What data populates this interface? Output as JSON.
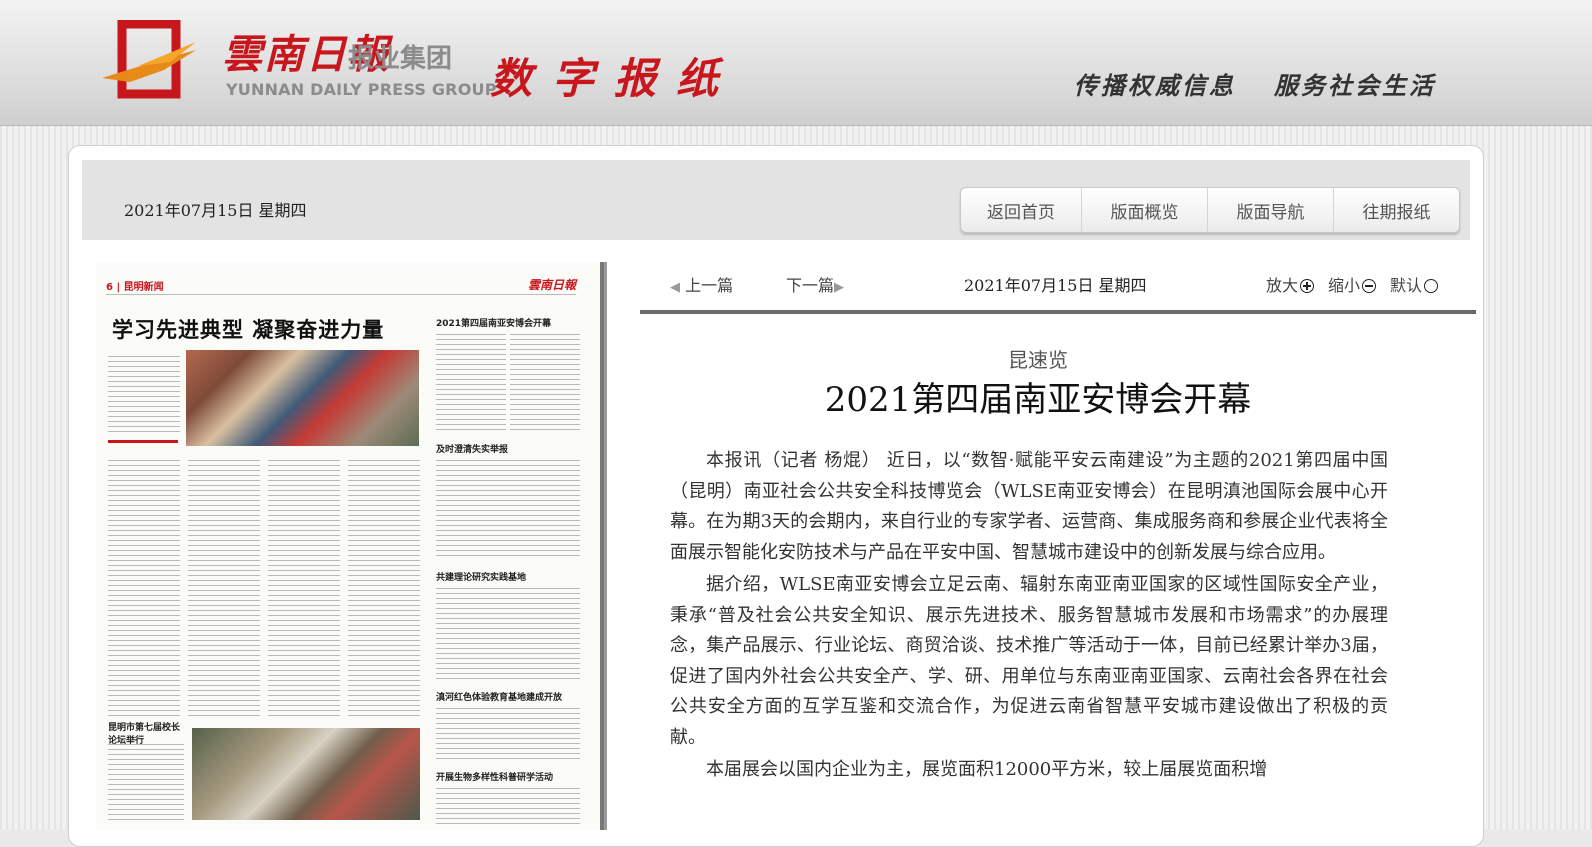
{
  "header": {
    "brand_cn": "雲南日報",
    "brand_sub": "报业集团",
    "brand_en": "YUNNAN DAILY PRESS GROUP",
    "title": "数字报纸",
    "slogan_left": "传播权威信息",
    "slogan_right": "服务社会生活"
  },
  "datebar": {
    "date": "2021年07月15日  星期四",
    "nav": [
      "返回首页",
      "版面概览",
      "版面导航",
      "往期报纸"
    ]
  },
  "page_thumb": {
    "page_label": "6 | 昆明新闻",
    "logo": "雲南日報",
    "headline": "学习先进典型  凝聚奋进力量",
    "side_heads": [
      "2021第四届南亚安博会开幕",
      "及时澄清失实举报",
      "共建理论研究实践基地",
      "滇河红色体验教育基地建成开放",
      "开展生物多样性科普研学活动",
      "昆明市第七届校长论坛举行"
    ]
  },
  "reader": {
    "prev": "上一篇",
    "next": "下一篇",
    "date": "2021年07月15日  星期四",
    "zoom_in": "放大",
    "zoom_out": "缩小",
    "default": "默认"
  },
  "article": {
    "kicker": "昆速览",
    "title": "2021第四届南亚安博会开幕",
    "paragraphs": [
      "本报讯（记者  杨焜）  近日，以“数智·赋能平安云南建设”为主题的2021第四届中国（昆明）南亚社会公共安全科技博览会（WLSE南亚安博会）在昆明滇池国际会展中心开幕。在为期3天的会期内，来自行业的专家学者、运营商、集成服务商和参展企业代表将全面展示智能化安防技术与产品在平安中国、智慧城市建设中的创新发展与综合应用。",
      "据介绍，WLSE南亚安博会立足云南、辐射东南亚南亚国家的区域性国际安全产业，秉承“普及社会公共安全知识、展示先进技术、服务智慧城市发展和市场需求”的办展理念，集产品展示、行业论坛、商贸洽谈、技术推广等活动于一体，目前已经累计举办3届，促进了国内外社会公共安全产、学、研、用单位与东南亚南亚国家、云南社会各界在社会公共安全方面的互学互鉴和交流合作，为促进云南省智慧平安城市建设做出了积极的贡献。",
      "本届展会以国内企业为主，展览面积12000平方米，较上届展览面积增"
    ]
  }
}
